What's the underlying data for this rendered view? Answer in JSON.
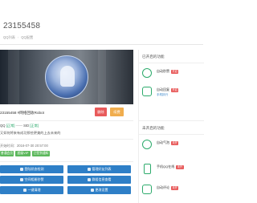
{
  "header": {
    "title": "23155458",
    "breadcrumbs": [
      "QQ列表",
      "QQ配置"
    ]
  },
  "profile": {
    "qq_name": "23155458 #网络回收Robot",
    "delete_label": "删除",
    "buy_label": "续费",
    "status_parts": [
      "QQ",
      "[正常]",
      "——",
      "SID",
      "[正常]"
    ],
    "signature": "又如何将来有成功那些更美的上去未来的",
    "time_label": "开始时间：",
    "time_value": "2016-07-30 20:57:00",
    "tags": [
      "普通会员",
      "超级VIP",
      "已签到通知"
    ],
    "tag_colors": [
      "#5cb85c",
      "#5cb85c",
      "#5cb85c"
    ]
  },
  "actions": [
    {
      "label": "登陆状态检测",
      "icon": "user-icon"
    },
    {
      "label": "管理好友列表",
      "icon": "user-icon"
    },
    {
      "label": "空间相册秒赞",
      "icon": "cloud-icon"
    },
    {
      "label": "群组信息查看",
      "icon": "cloud-icon"
    },
    {
      "label": "一键清理",
      "icon": "trash-icon"
    },
    {
      "label": "更改设置",
      "icon": "gear-icon"
    }
  ],
  "sidebar": {
    "enabled_title": "已开启的功能",
    "enabled": [
      {
        "name": "自动秒赞",
        "badge": "开启",
        "icon": "refresh-icon"
      },
      {
        "name": "自动回复",
        "badge": "开启",
        "icon": "chat-icon",
        "sub": "手机执行"
      }
    ],
    "disabled_title": "未开启的功能",
    "disabled": [
      {
        "name": "自动气泡",
        "badge": "未开",
        "icon": "bubble-icon"
      },
      {
        "name": "手机QQ在线",
        "badge": "未开",
        "icon": "phone-icon"
      },
      {
        "name": "自动评论",
        "badge": "未开",
        "icon": "comment-icon"
      }
    ]
  },
  "colors": {
    "primary": "#2e7fc7",
    "danger": "#e85a5a",
    "warning": "#f0ad4e",
    "success": "#1aa260"
  }
}
